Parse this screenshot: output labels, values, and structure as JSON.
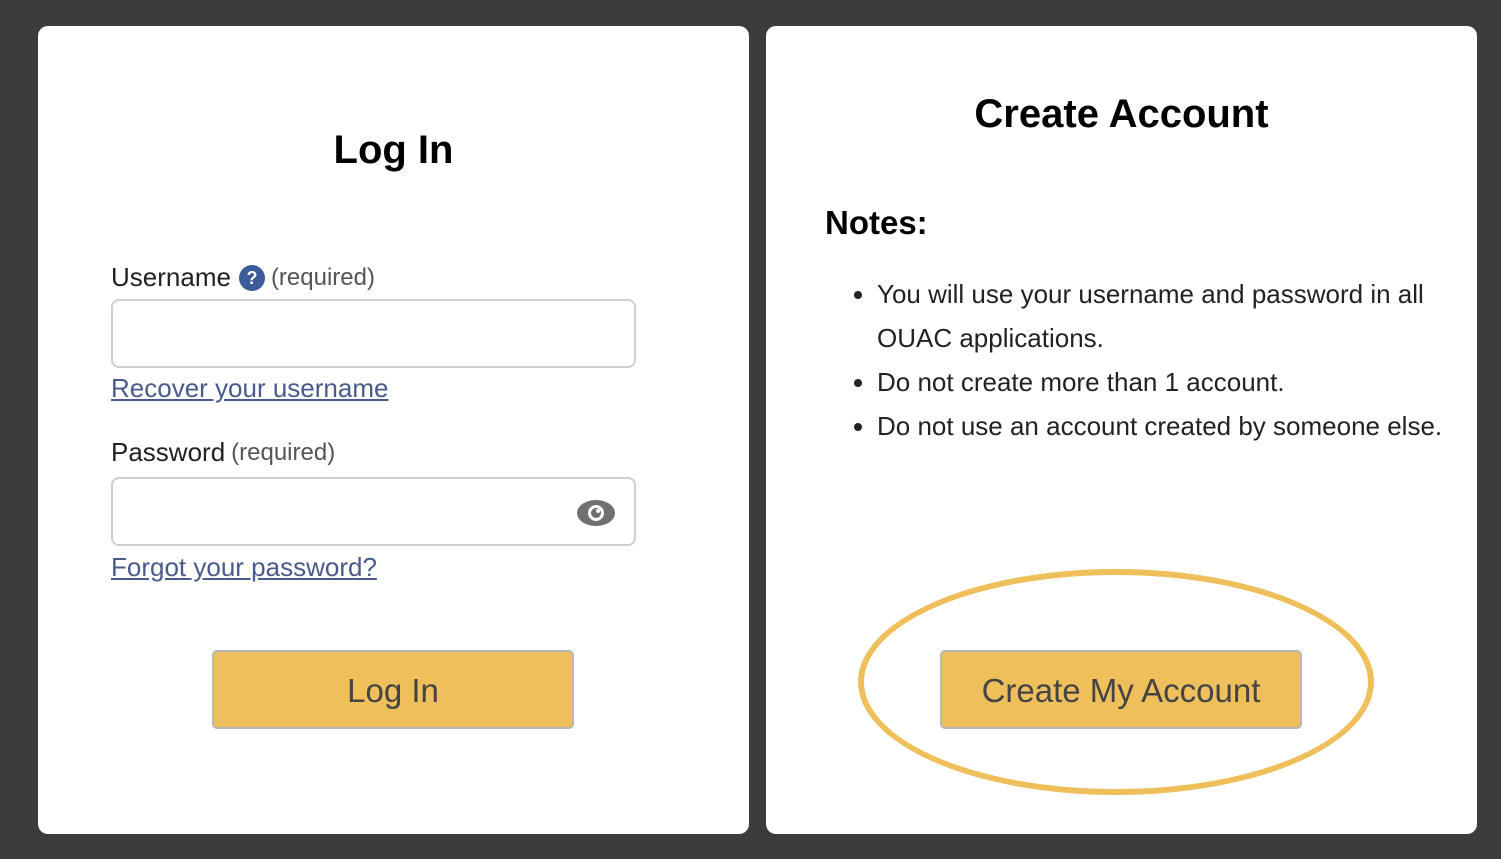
{
  "login": {
    "title": "Log In",
    "username_label": "Username",
    "username_help": "?",
    "username_required": "(required)",
    "username_value": "",
    "recover_username_link": "Recover your username",
    "password_label": "Password",
    "password_required": "(required)",
    "password_value": "",
    "forgot_password_link": "Forgot your password?",
    "button_label": "Log In"
  },
  "create": {
    "title": "Create Account",
    "notes_heading": "Notes:",
    "notes": [
      "You will use your username and password in all OUAC applications.",
      "Do not create more than 1 account.",
      "Do not use an account created by someone else."
    ],
    "button_label": "Create My Account"
  },
  "colors": {
    "background": "#3c3c3c",
    "button": "#eebf5a",
    "link": "#4a5a8c",
    "help_icon": "#3d5a9a",
    "highlight": "#eebf5a"
  },
  "icons": {
    "help": "help-icon",
    "password_toggle": "eye-icon"
  }
}
